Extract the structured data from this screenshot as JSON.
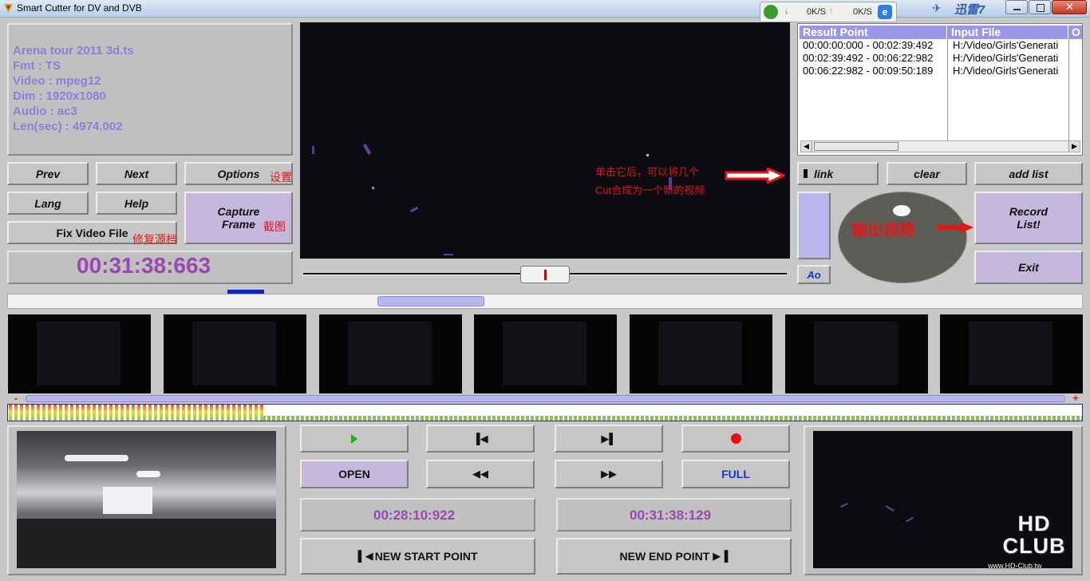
{
  "window": {
    "title": "Smart Cutter for DV and DVB"
  },
  "tray": {
    "down_speed": "0K/S",
    "up_speed": "0K/S",
    "xunlei": "迅雷7"
  },
  "info": {
    "filename": "Arena tour 2011 3d.ts",
    "fmt": "Fmt : TS",
    "video": "Video : mpeg12",
    "dim": "Dim : 1920x1080",
    "audio": "Audio : ac3",
    "len": "Len(sec) : 4974.002"
  },
  "buttons": {
    "prev": "Prev",
    "next": "Next",
    "options": "Options",
    "lang": "Lang",
    "help": "Help",
    "capture": "Capture Frame",
    "fix": "Fix Video File",
    "link": "link",
    "clear": "clear",
    "add_list": "add list",
    "record": "Record List!",
    "exit": "Exit",
    "ao": "Ao",
    "open": "OPEN",
    "full": "FULL",
    "new_start": "NEW START POINT",
    "new_end": "NEW END POINT"
  },
  "notes": {
    "options": "设置",
    "fix": "修复源档",
    "capture": "截图",
    "link_tip": "单击它后，可以将几个Cut合成为一个新的视频",
    "output": "输出视频"
  },
  "times": {
    "current": "00:31:38:663",
    "start": "00:28:10:922",
    "end": "00:31:38:129"
  },
  "result_list": {
    "headers": [
      "Result Point",
      "Input File",
      "O"
    ],
    "rows": [
      [
        "00:00:00:000 - 00:02:39:492",
        "H:/Video/Girls'Generati"
      ],
      [
        "00:02:39:492 - 00:06:22:982",
        "H:/Video/Girls'Generati"
      ],
      [
        "00:06:22:982 - 00:09:50:189",
        "H:/Video/Girls'Generati"
      ]
    ]
  },
  "zoom": {
    "minus": "-",
    "plus": "+"
  },
  "watermark": {
    "logo": "HD CLUB",
    "url": "www.HD-Club.tw"
  },
  "colors": {
    "accent_purple": "#9a48b0",
    "info_text": "#8b7fd9",
    "note_red": "#e01818",
    "list_header": "#9d96e8"
  }
}
